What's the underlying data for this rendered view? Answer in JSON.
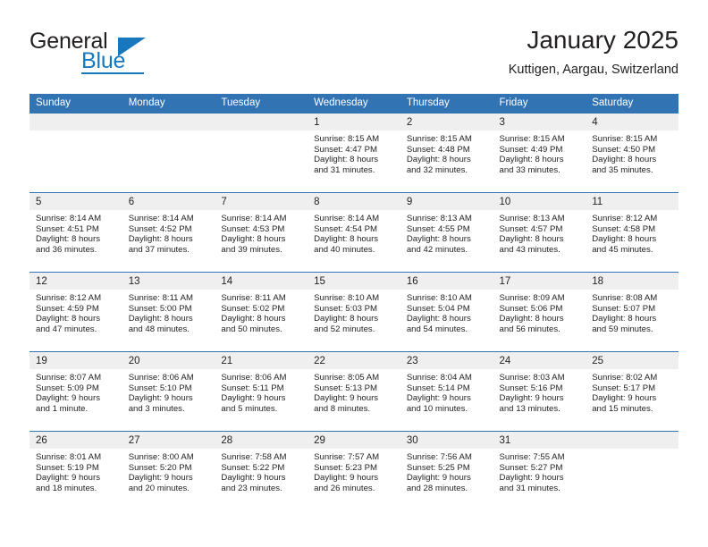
{
  "brand": {
    "name_part1": "General",
    "name_part2": "Blue",
    "triangle_icon": "triangle-icon",
    "accent_color": "#1878be"
  },
  "header": {
    "title": "January 2025",
    "location": "Kuttigen, Aargau, Switzerland"
  },
  "theme": {
    "header_blue": "#3273b3",
    "daynum_band": "#efefef",
    "text": "#231f20"
  },
  "weekdays": [
    "Sunday",
    "Monday",
    "Tuesday",
    "Wednesday",
    "Thursday",
    "Friday",
    "Saturday"
  ],
  "weeks": [
    [
      {
        "day": "",
        "empty": true
      },
      {
        "day": "",
        "empty": true
      },
      {
        "day": "",
        "empty": true
      },
      {
        "day": "1",
        "sunrise": "Sunrise: 8:15 AM",
        "sunset": "Sunset: 4:47 PM",
        "daylight_line1": "Daylight: 8 hours",
        "daylight_line2": "and 31 minutes."
      },
      {
        "day": "2",
        "sunrise": "Sunrise: 8:15 AM",
        "sunset": "Sunset: 4:48 PM",
        "daylight_line1": "Daylight: 8 hours",
        "daylight_line2": "and 32 minutes."
      },
      {
        "day": "3",
        "sunrise": "Sunrise: 8:15 AM",
        "sunset": "Sunset: 4:49 PM",
        "daylight_line1": "Daylight: 8 hours",
        "daylight_line2": "and 33 minutes."
      },
      {
        "day": "4",
        "sunrise": "Sunrise: 8:15 AM",
        "sunset": "Sunset: 4:50 PM",
        "daylight_line1": "Daylight: 8 hours",
        "daylight_line2": "and 35 minutes."
      }
    ],
    [
      {
        "day": "5",
        "sunrise": "Sunrise: 8:14 AM",
        "sunset": "Sunset: 4:51 PM",
        "daylight_line1": "Daylight: 8 hours",
        "daylight_line2": "and 36 minutes."
      },
      {
        "day": "6",
        "sunrise": "Sunrise: 8:14 AM",
        "sunset": "Sunset: 4:52 PM",
        "daylight_line1": "Daylight: 8 hours",
        "daylight_line2": "and 37 minutes."
      },
      {
        "day": "7",
        "sunrise": "Sunrise: 8:14 AM",
        "sunset": "Sunset: 4:53 PM",
        "daylight_line1": "Daylight: 8 hours",
        "daylight_line2": "and 39 minutes."
      },
      {
        "day": "8",
        "sunrise": "Sunrise: 8:14 AM",
        "sunset": "Sunset: 4:54 PM",
        "daylight_line1": "Daylight: 8 hours",
        "daylight_line2": "and 40 minutes."
      },
      {
        "day": "9",
        "sunrise": "Sunrise: 8:13 AM",
        "sunset": "Sunset: 4:55 PM",
        "daylight_line1": "Daylight: 8 hours",
        "daylight_line2": "and 42 minutes."
      },
      {
        "day": "10",
        "sunrise": "Sunrise: 8:13 AM",
        "sunset": "Sunset: 4:57 PM",
        "daylight_line1": "Daylight: 8 hours",
        "daylight_line2": "and 43 minutes."
      },
      {
        "day": "11",
        "sunrise": "Sunrise: 8:12 AM",
        "sunset": "Sunset: 4:58 PM",
        "daylight_line1": "Daylight: 8 hours",
        "daylight_line2": "and 45 minutes."
      }
    ],
    [
      {
        "day": "12",
        "sunrise": "Sunrise: 8:12 AM",
        "sunset": "Sunset: 4:59 PM",
        "daylight_line1": "Daylight: 8 hours",
        "daylight_line2": "and 47 minutes."
      },
      {
        "day": "13",
        "sunrise": "Sunrise: 8:11 AM",
        "sunset": "Sunset: 5:00 PM",
        "daylight_line1": "Daylight: 8 hours",
        "daylight_line2": "and 48 minutes."
      },
      {
        "day": "14",
        "sunrise": "Sunrise: 8:11 AM",
        "sunset": "Sunset: 5:02 PM",
        "daylight_line1": "Daylight: 8 hours",
        "daylight_line2": "and 50 minutes."
      },
      {
        "day": "15",
        "sunrise": "Sunrise: 8:10 AM",
        "sunset": "Sunset: 5:03 PM",
        "daylight_line1": "Daylight: 8 hours",
        "daylight_line2": "and 52 minutes."
      },
      {
        "day": "16",
        "sunrise": "Sunrise: 8:10 AM",
        "sunset": "Sunset: 5:04 PM",
        "daylight_line1": "Daylight: 8 hours",
        "daylight_line2": "and 54 minutes."
      },
      {
        "day": "17",
        "sunrise": "Sunrise: 8:09 AM",
        "sunset": "Sunset: 5:06 PM",
        "daylight_line1": "Daylight: 8 hours",
        "daylight_line2": "and 56 minutes."
      },
      {
        "day": "18",
        "sunrise": "Sunrise: 8:08 AM",
        "sunset": "Sunset: 5:07 PM",
        "daylight_line1": "Daylight: 8 hours",
        "daylight_line2": "and 59 minutes."
      }
    ],
    [
      {
        "day": "19",
        "sunrise": "Sunrise: 8:07 AM",
        "sunset": "Sunset: 5:09 PM",
        "daylight_line1": "Daylight: 9 hours",
        "daylight_line2": "and 1 minute."
      },
      {
        "day": "20",
        "sunrise": "Sunrise: 8:06 AM",
        "sunset": "Sunset: 5:10 PM",
        "daylight_line1": "Daylight: 9 hours",
        "daylight_line2": "and 3 minutes."
      },
      {
        "day": "21",
        "sunrise": "Sunrise: 8:06 AM",
        "sunset": "Sunset: 5:11 PM",
        "daylight_line1": "Daylight: 9 hours",
        "daylight_line2": "and 5 minutes."
      },
      {
        "day": "22",
        "sunrise": "Sunrise: 8:05 AM",
        "sunset": "Sunset: 5:13 PM",
        "daylight_line1": "Daylight: 9 hours",
        "daylight_line2": "and 8 minutes."
      },
      {
        "day": "23",
        "sunrise": "Sunrise: 8:04 AM",
        "sunset": "Sunset: 5:14 PM",
        "daylight_line1": "Daylight: 9 hours",
        "daylight_line2": "and 10 minutes."
      },
      {
        "day": "24",
        "sunrise": "Sunrise: 8:03 AM",
        "sunset": "Sunset: 5:16 PM",
        "daylight_line1": "Daylight: 9 hours",
        "daylight_line2": "and 13 minutes."
      },
      {
        "day": "25",
        "sunrise": "Sunrise: 8:02 AM",
        "sunset": "Sunset: 5:17 PM",
        "daylight_line1": "Daylight: 9 hours",
        "daylight_line2": "and 15 minutes."
      }
    ],
    [
      {
        "day": "26",
        "sunrise": "Sunrise: 8:01 AM",
        "sunset": "Sunset: 5:19 PM",
        "daylight_line1": "Daylight: 9 hours",
        "daylight_line2": "and 18 minutes."
      },
      {
        "day": "27",
        "sunrise": "Sunrise: 8:00 AM",
        "sunset": "Sunset: 5:20 PM",
        "daylight_line1": "Daylight: 9 hours",
        "daylight_line2": "and 20 minutes."
      },
      {
        "day": "28",
        "sunrise": "Sunrise: 7:58 AM",
        "sunset": "Sunset: 5:22 PM",
        "daylight_line1": "Daylight: 9 hours",
        "daylight_line2": "and 23 minutes."
      },
      {
        "day": "29",
        "sunrise": "Sunrise: 7:57 AM",
        "sunset": "Sunset: 5:23 PM",
        "daylight_line1": "Daylight: 9 hours",
        "daylight_line2": "and 26 minutes."
      },
      {
        "day": "30",
        "sunrise": "Sunrise: 7:56 AM",
        "sunset": "Sunset: 5:25 PM",
        "daylight_line1": "Daylight: 9 hours",
        "daylight_line2": "and 28 minutes."
      },
      {
        "day": "31",
        "sunrise": "Sunrise: 7:55 AM",
        "sunset": "Sunset: 5:27 PM",
        "daylight_line1": "Daylight: 9 hours",
        "daylight_line2": "and 31 minutes."
      },
      {
        "day": "",
        "empty": true
      }
    ]
  ]
}
